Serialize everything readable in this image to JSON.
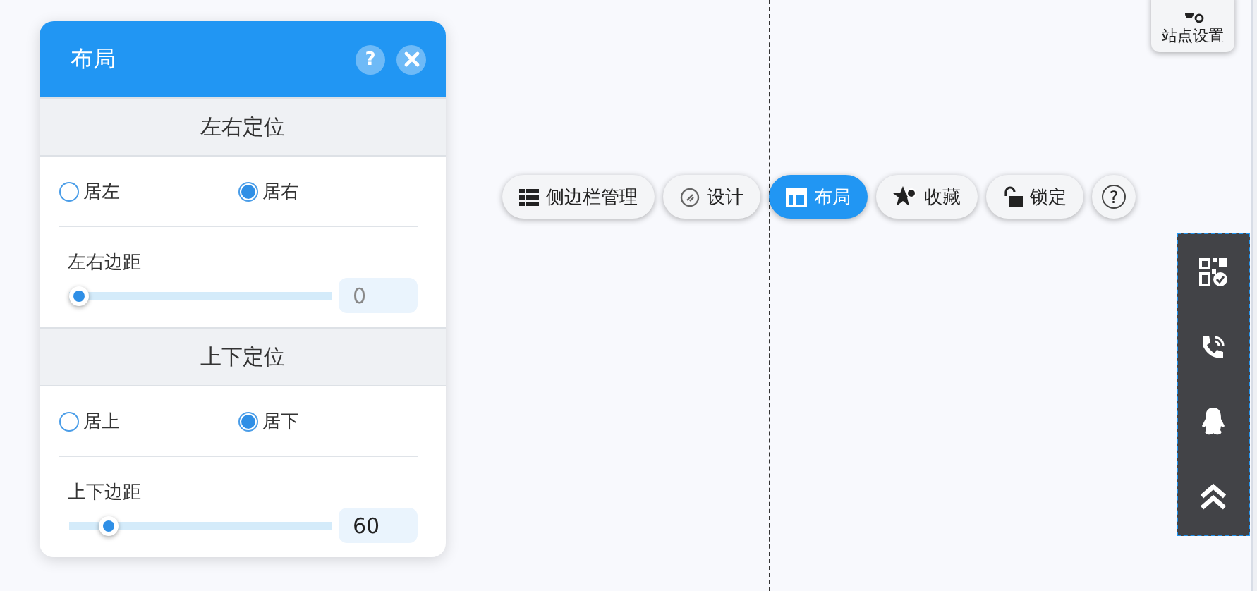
{
  "panel": {
    "title": "布局",
    "help": "?",
    "sections": [
      {
        "heading": "左右定位",
        "options": [
          {
            "label": "居左",
            "selected": false
          },
          {
            "label": "居右",
            "selected": true
          }
        ],
        "margin_label": "左右边距",
        "level": 0,
        "placeholder": "0"
      },
      {
        "heading": "上下定位",
        "options": [
          {
            "label": "居上",
            "selected": false
          },
          {
            "label": "居下",
            "selected": true
          }
        ],
        "margin_label": "上下边距",
        "level": 0.12,
        "value": "60"
      }
    ]
  },
  "toolbar": [
    {
      "kind": "sidebar",
      "label": "侧边栏管理",
      "selected": false
    },
    {
      "kind": "design",
      "label": "设计",
      "selected": false
    },
    {
      "kind": "layout",
      "label": "布局",
      "selected": true
    },
    {
      "kind": "favorite",
      "label": "收藏",
      "selected": false
    },
    {
      "kind": "lock",
      "label": "锁定",
      "selected": false
    },
    {
      "kind": "help",
      "label": "?",
      "selected": false
    }
  ],
  "site_settings": {
    "label": "站点设置"
  }
}
